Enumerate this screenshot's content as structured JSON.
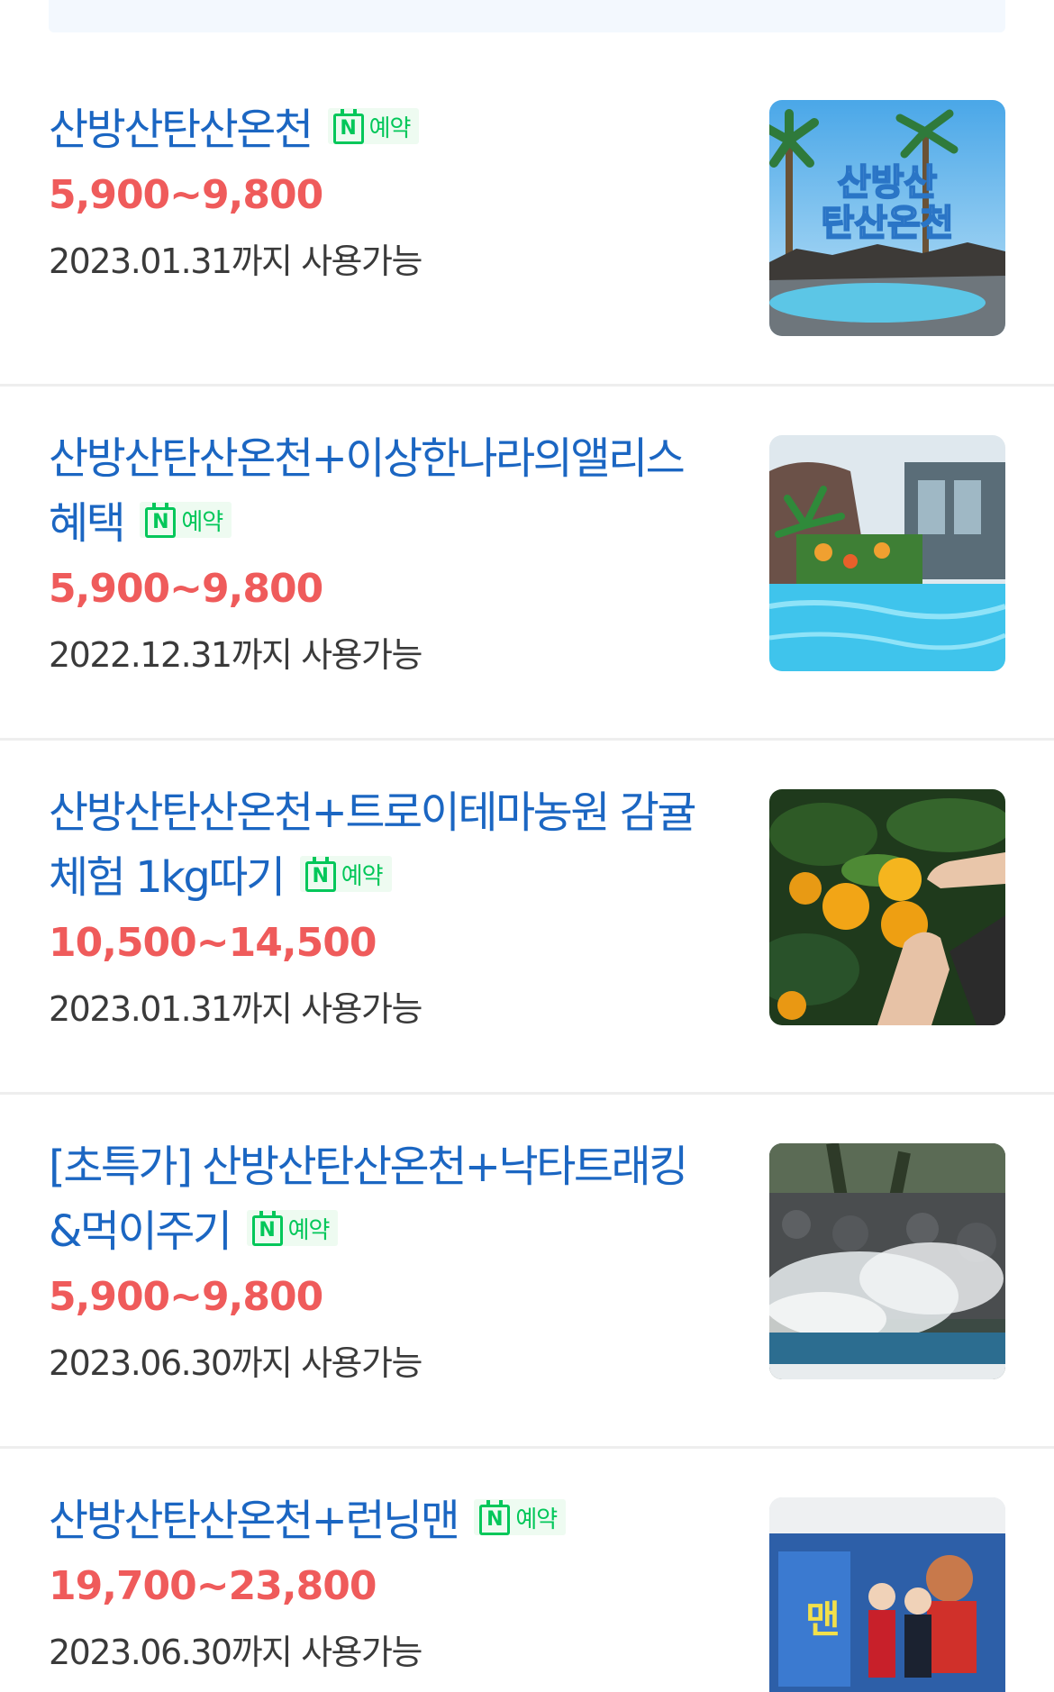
{
  "deals": [
    {
      "title": "산방산탄산온천",
      "badge_label": "예약",
      "price": "5,900~9,800",
      "validity": "2023.01.31까지 사용가능",
      "thumb_text": [
        "산방산",
        "탄산온천"
      ]
    },
    {
      "title": "산방산탄산온천+이상한나라의앨리스 혜택",
      "badge_label": "예약",
      "price": "5,900~9,800",
      "validity": "2022.12.31까지 사용가능"
    },
    {
      "title": "산방산탄산온천+트로이테마농원 감귤체험 1kg따기",
      "badge_label": "예약",
      "price": "10,500~14,500",
      "validity": "2023.01.31까지 사용가능"
    },
    {
      "title": "[초특가] 산방산탄산온천+낙타트래킹&먹이주기",
      "badge_label": "예약",
      "price": "5,900~9,800",
      "validity": "2023.06.30까지 사용가능"
    },
    {
      "title": "산방산탄산온천+런닝맨",
      "badge_label": "예약",
      "price": "19,700~23,800",
      "validity": "2023.06.30까지 사용가능"
    }
  ],
  "icons": {
    "badge_icon": "naver-booking-calendar-icon"
  },
  "colors": {
    "title": "#1b66c2",
    "price": "#ef5b5b",
    "badge": "#03c75a"
  }
}
